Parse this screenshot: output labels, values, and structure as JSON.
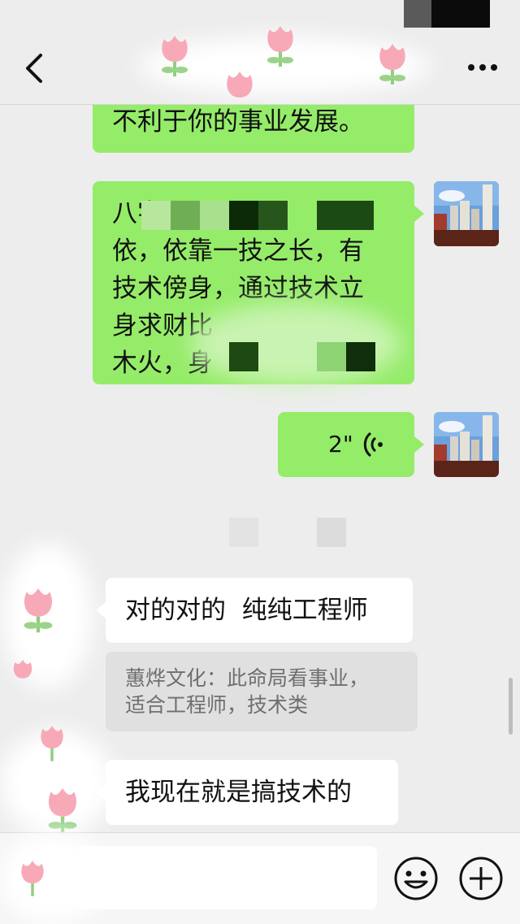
{
  "nav": {
    "back_icon": "chevron-left-icon",
    "more_icon": "ellipsis-icon"
  },
  "messages": [
    {
      "side": "right",
      "text": "不利于你的事业发展。"
    },
    {
      "side": "right",
      "lines": [
        "八字",
        "依，依靠一技之长，有",
        "技术傍身，通过技术立",
        "身求财比",
        "木火，身"
      ]
    },
    {
      "side": "right",
      "type": "voice",
      "duration": "2\""
    },
    {
      "side": "left",
      "text": "对的对的  纯纯工程师"
    },
    {
      "side": "left",
      "type": "quote",
      "lines": [
        "蕙烨文化：此命局看事业，",
        "适合工程师，技术类"
      ]
    },
    {
      "side": "left",
      "text": "我现在就是搞技术的"
    }
  ],
  "input_bar": {
    "emoji_icon": "smiley-icon",
    "plus_icon": "plus-circle-icon"
  },
  "colors": {
    "sent_bubble": "#95ec69",
    "received_bubble": "#ffffff",
    "background": "#ededed",
    "quote_bg": "#e0e0e0"
  }
}
